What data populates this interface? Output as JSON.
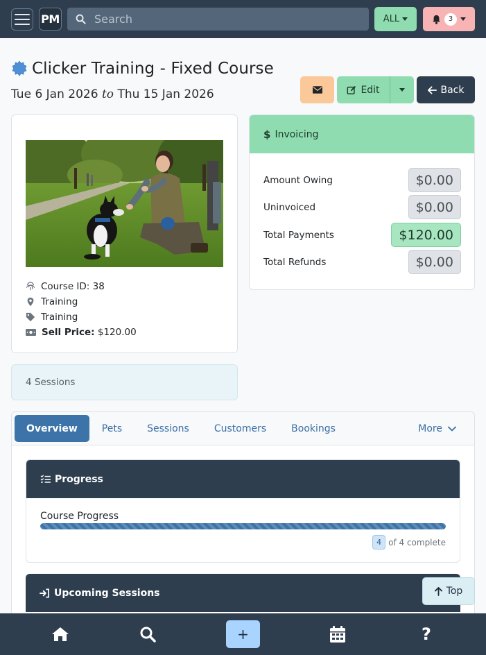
{
  "topbar": {
    "logo": "PM",
    "search_placeholder": "Search",
    "filter_label": "ALL",
    "notification_count": "3"
  },
  "course": {
    "title": "Clicker Training - Fixed Course",
    "start_date": "Tue 6 Jan 2026",
    "date_separator": "to",
    "end_date": "Thu 15 Jan 2026"
  },
  "actions": {
    "edit_label": "Edit",
    "back_label": "Back"
  },
  "info": {
    "course_id": "Course ID: 38",
    "location": "Training",
    "category": "Training",
    "sell_price_label": "Sell Price:",
    "sell_price_value": "$120.00"
  },
  "invoicing": {
    "heading": "Invoicing",
    "rows": [
      {
        "label": "Amount Owing",
        "value": "$0.00"
      },
      {
        "label": "Uninvoiced",
        "value": "$0.00"
      },
      {
        "label": "Total Payments",
        "value": "$120.00"
      },
      {
        "label": "Total Refunds",
        "value": "$0.00"
      }
    ]
  },
  "sessions_summary": "4 Sessions",
  "tabs": [
    {
      "label": "Overview"
    },
    {
      "label": "Pets"
    },
    {
      "label": "Sessions"
    },
    {
      "label": "Customers"
    },
    {
      "label": "Bookings"
    },
    {
      "label": "More"
    }
  ],
  "progress": {
    "heading": "Progress",
    "label": "Course Progress",
    "completed": "4",
    "of_text": "of 4 complete",
    "fraction": 1.0
  },
  "upcoming": {
    "heading": "Upcoming Sessions"
  },
  "scroll_top_label": "Top",
  "colors": {
    "navbar": "#2f3e4f",
    "success": "#8fdcb0",
    "warning": "#fbc89a",
    "danger_light": "#f8b4b4",
    "primary": "#3c73a8"
  }
}
